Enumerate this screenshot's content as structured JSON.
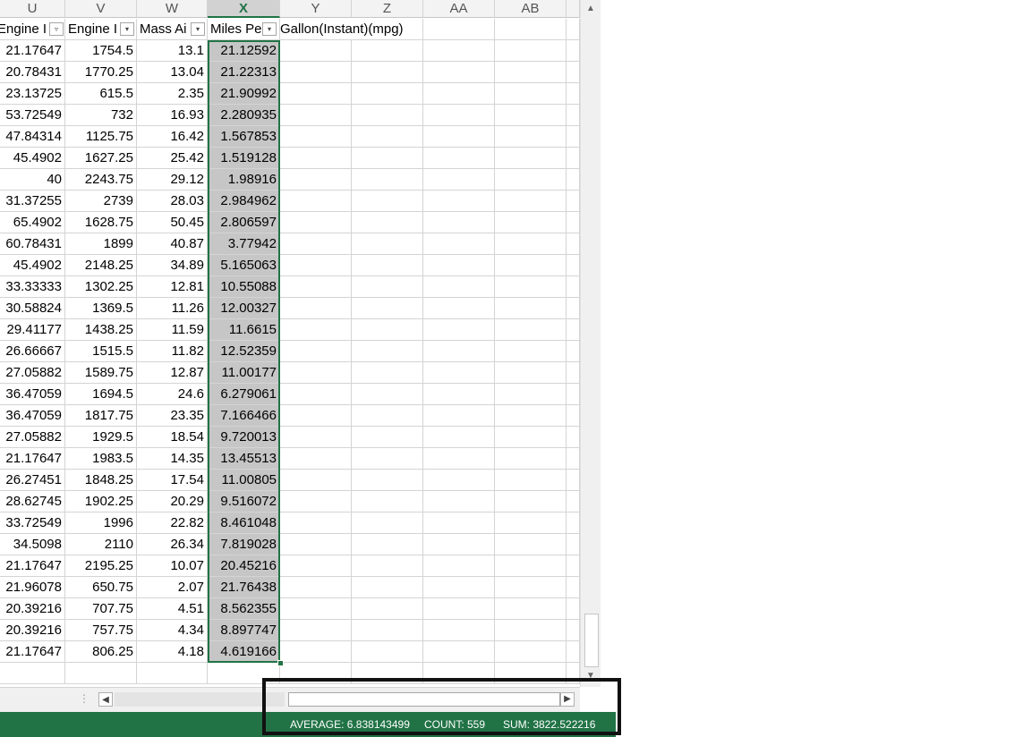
{
  "columns": [
    "U",
    "V",
    "W",
    "X",
    "Y",
    "Z",
    "AA",
    "AB"
  ],
  "headers": {
    "u": "Engine I",
    "v": "Engine I",
    "w": "Mass Ai",
    "x": "Miles Pe",
    "y": "Gallon(Instant)(mpg)"
  },
  "rows": [
    [
      "21.17647",
      "1754.5",
      "13.1",
      "21.12592"
    ],
    [
      "20.78431",
      "1770.25",
      "13.04",
      "21.22313"
    ],
    [
      "23.13725",
      "615.5",
      "2.35",
      "21.90992"
    ],
    [
      "53.72549",
      "732",
      "16.93",
      "2.280935"
    ],
    [
      "47.84314",
      "1125.75",
      "16.42",
      "1.567853"
    ],
    [
      "45.4902",
      "1627.25",
      "25.42",
      "1.519128"
    ],
    [
      "40",
      "2243.75",
      "29.12",
      "1.98916"
    ],
    [
      "31.37255",
      "2739",
      "28.03",
      "2.984962"
    ],
    [
      "65.4902",
      "1628.75",
      "50.45",
      "2.806597"
    ],
    [
      "60.78431",
      "1899",
      "40.87",
      "3.77942"
    ],
    [
      "45.4902",
      "2148.25",
      "34.89",
      "5.165063"
    ],
    [
      "33.33333",
      "1302.25",
      "12.81",
      "10.55088"
    ],
    [
      "30.58824",
      "1369.5",
      "11.26",
      "12.00327"
    ],
    [
      "29.41177",
      "1438.25",
      "11.59",
      "11.6615"
    ],
    [
      "26.66667",
      "1515.5",
      "11.82",
      "12.52359"
    ],
    [
      "27.05882",
      "1589.75",
      "12.87",
      "11.00177"
    ],
    [
      "36.47059",
      "1694.5",
      "24.6",
      "6.279061"
    ],
    [
      "36.47059",
      "1817.75",
      "23.35",
      "7.166466"
    ],
    [
      "27.05882",
      "1929.5",
      "18.54",
      "9.720013"
    ],
    [
      "21.17647",
      "1983.5",
      "14.35",
      "13.45513"
    ],
    [
      "26.27451",
      "1848.25",
      "17.54",
      "11.00805"
    ],
    [
      "28.62745",
      "1902.25",
      "20.29",
      "9.516072"
    ],
    [
      "33.72549",
      "1996",
      "22.82",
      "8.461048"
    ],
    [
      "34.5098",
      "2110",
      "26.34",
      "7.819028"
    ],
    [
      "21.17647",
      "2195.25",
      "10.07",
      "20.45216"
    ],
    [
      "21.96078",
      "650.75",
      "2.07",
      "21.76438"
    ],
    [
      "20.39216",
      "707.75",
      "4.51",
      "8.562355"
    ],
    [
      "20.39216",
      "757.75",
      "4.34",
      "8.897747"
    ],
    [
      "21.17647",
      "806.25",
      "4.18",
      "4.619166"
    ]
  ],
  "status": {
    "average": "AVERAGE: 6.838143499",
    "count": "COUNT: 559",
    "sum": "SUM: 3822.522216"
  },
  "colors": {
    "accent": "#217346",
    "selection": "#c6c6c6"
  }
}
